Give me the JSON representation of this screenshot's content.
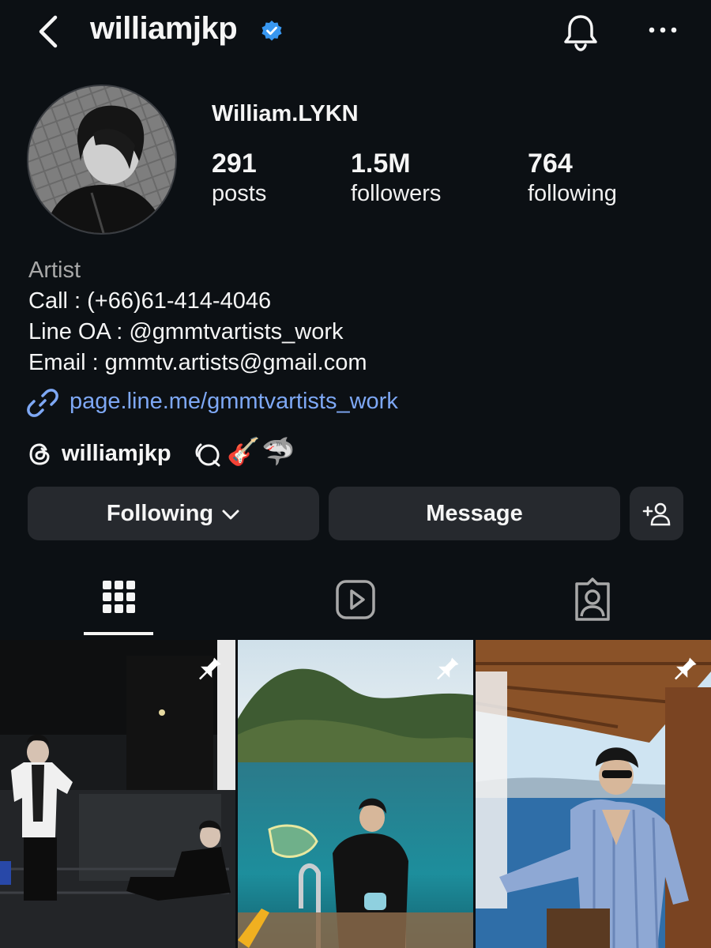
{
  "header": {
    "username": "williamjkp",
    "verified_icon": "verified-badge-icon",
    "back_icon": "chevron-left-icon",
    "notifications_icon": "bell-icon",
    "more_icon": "more-horizontal-icon"
  },
  "profile": {
    "display_name": "William.LYKN",
    "stats": [
      {
        "value": "291",
        "label": "posts"
      },
      {
        "value": "1.5M",
        "label": "followers"
      },
      {
        "value": "764",
        "label": "following"
      }
    ],
    "bio": {
      "category": "Artist",
      "lines": [
        "Call : (+66)61-414-4046",
        "Line OA : @gmmtvartists_work",
        "Email : gmmtv.artists@gmail.com"
      ],
      "link": "page.line.me/gmmtvartists_work",
      "threads_handle": "williamjkp",
      "emojis": [
        "🎸",
        "🦈"
      ]
    }
  },
  "actions": {
    "following_label": "Following",
    "message_label": "Message",
    "add_user_icon": "add-user-icon"
  },
  "tabs": [
    {
      "name": "posts-grid",
      "icon": "grid-icon",
      "active": true
    },
    {
      "name": "reels",
      "icon": "reels-icon",
      "active": false
    },
    {
      "name": "tagged",
      "icon": "tagged-icon",
      "active": false
    }
  ],
  "posts": [
    {
      "pinned": true,
      "scene": "two men in dark stairwell"
    },
    {
      "pinned": true,
      "scene": "man on boat ladder at sea near island"
    },
    {
      "pinned": true,
      "scene": "man in striped shirt on boat deck"
    }
  ],
  "colors": {
    "background": "#0c1014",
    "button": "#26292e",
    "link": "#7ea8f5",
    "verified": "#3897f0",
    "muted_text": "#a8a8a8"
  }
}
